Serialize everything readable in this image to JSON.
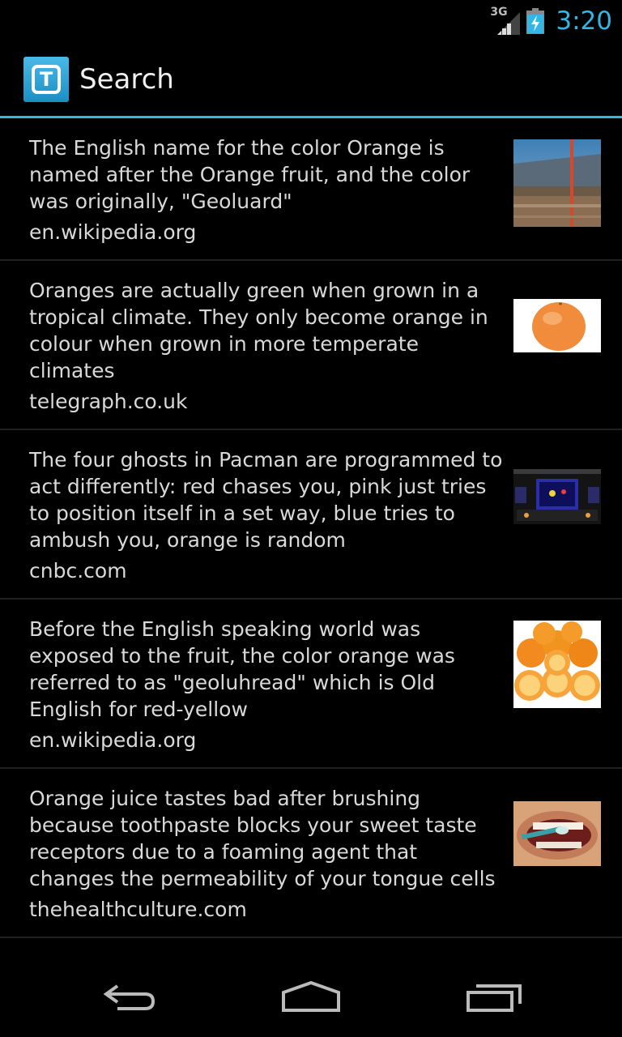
{
  "status_bar": {
    "network_type": "3G",
    "time": "3:20"
  },
  "action_bar": {
    "app_icon_letter": "T",
    "title": "Search"
  },
  "results": [
    {
      "fact": "The English name for the color Orange is named after the Orange fruit, and the color was originally, \"Geoluard\"",
      "source": "en.wikipedia.org",
      "thumbnail": "stadium-crowd-image"
    },
    {
      "fact": "Oranges are actually green when grown in a tropical climate. They only become orange in colour when grown in more temperate climates",
      "source": "telegraph.co.uk",
      "thumbnail": "orange-fruit-image"
    },
    {
      "fact": "The four ghosts in Pacman are programmed to act differently: red chases you, pink just tries to position itself in a set way, blue tries to ambush you, orange is random",
      "source": "cnbc.com",
      "thumbnail": "pacman-arcade-image"
    },
    {
      "fact": "Before the English speaking world was exposed to the fruit, the color orange was referred to as \"geoluhread\" which is Old English for red-yellow",
      "source": "en.wikipedia.org",
      "thumbnail": "sliced-oranges-image"
    },
    {
      "fact": "Orange juice tastes bad after brushing because toothpaste blocks your sweet taste receptors due to a foaming agent that changes the permeability of your tongue cells",
      "source": "thehealthculture.com",
      "thumbnail": "brushing-teeth-image"
    }
  ],
  "nav_bar": {
    "back": "back-icon",
    "home": "home-icon",
    "recents": "recent-apps-icon"
  },
  "colors": {
    "accent": "#33b5e5",
    "background": "#000000",
    "text": "#d9d9d9",
    "divider": "#1f1f1f"
  }
}
